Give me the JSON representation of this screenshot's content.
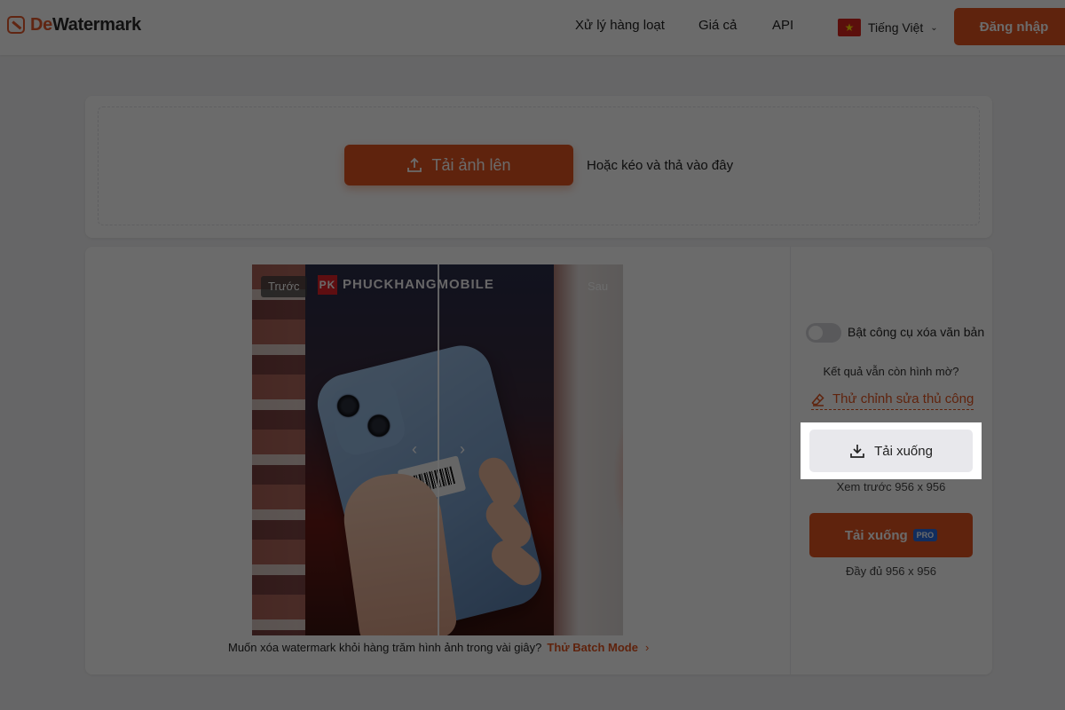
{
  "header": {
    "logo_prefix": "De",
    "logo_suffix": "Watermark",
    "nav": [
      {
        "label": "Xử lý hàng loạt"
      },
      {
        "label": "Giá cả"
      },
      {
        "label": "API"
      }
    ],
    "language": "Tiếng Việt",
    "login_label": "Đăng nhập"
  },
  "upload": {
    "button_label": "Tải ảnh lên",
    "drop_hint": "Hoặc kéo và thả vào đây"
  },
  "preview": {
    "before_label": "Trước",
    "after_label": "Sau",
    "brand_text": "PHUCKHANGMOBILE",
    "batch_prompt": "Muốn xóa watermark khỏi hàng trăm hình ảnh trong vài giây?",
    "batch_link": "Thử Batch Mode",
    "batch_arrow": "›"
  },
  "panel": {
    "toggle_label": "Bật công cụ xóa văn bản",
    "toggle_on": false,
    "hint": "Kết quả vẫn còn hình mờ?",
    "manual_link": "Thử chỉnh sửa thủ công",
    "download_free_label": "Tải xuống",
    "free_size_note": "Xem trước 956 x 956",
    "download_pro_label": "Tải xuống",
    "pro_badge": "PRO",
    "pro_size_note": "Đầy đủ 956 x 956"
  },
  "colors": {
    "accent": "#e3531f",
    "pro_badge": "#2a6de0",
    "flag_red": "#da251d",
    "flag_star": "#ffde00"
  }
}
